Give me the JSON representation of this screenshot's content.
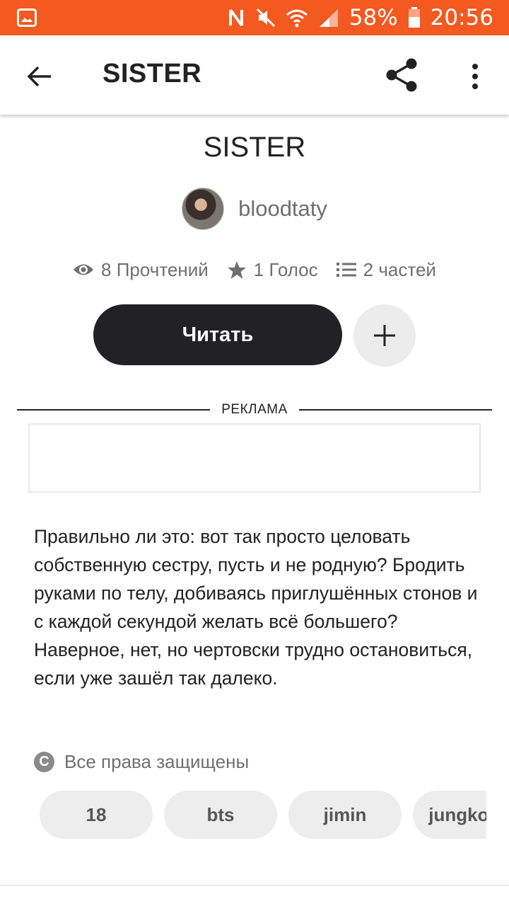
{
  "status_bar": {
    "battery": "58%",
    "time": "20:56",
    "icons": [
      "image-icon",
      "nfc-icon",
      "mute-icon",
      "wifi-icon",
      "signal-icon",
      "battery-icon"
    ]
  },
  "app_bar": {
    "title": "SISTER",
    "icons": [
      "back-arrow-icon",
      "share-icon",
      "more-vertical-icon"
    ]
  },
  "story": {
    "title": "SISTER",
    "author": "bloodtaty",
    "stats": {
      "reads": "8 Прочтений",
      "votes": "1 Голос",
      "parts": "2 частей"
    },
    "read_button": "Читать",
    "add_icon": "plus-icon"
  },
  "ad": {
    "label": "РЕКЛАМА"
  },
  "description": "Правильно ли это: вот так просто целовать собственную сестру, пусть и не родную? Бродить руками по телу, добиваясь приглушённых стонов и с каждой секундой желать всё большего? Наверное, нет, но чертовски трудно остановиться, если уже зашёл так далеко.",
  "copyright": {
    "icon": "copyright-icon",
    "text": "Все права защищены"
  },
  "tags": [
    "18",
    "bts",
    "jimin",
    "jungkook"
  ],
  "colors": {
    "status_bar": "#f4591f",
    "read_button": "#222225",
    "tag_bg": "#ededed"
  }
}
